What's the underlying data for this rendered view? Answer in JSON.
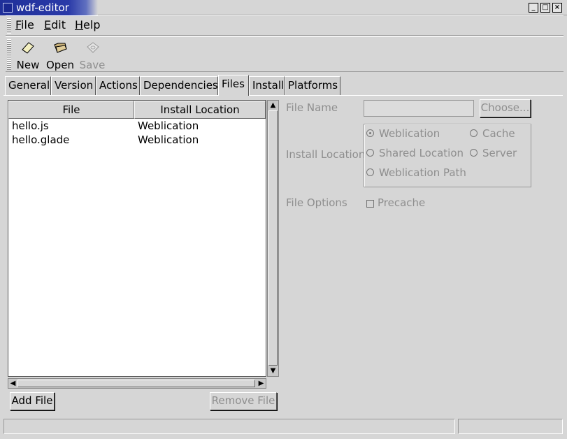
{
  "window": {
    "title": "wdf-editor",
    "wm_buttons": [
      "minimize-icon",
      "maximize-icon",
      "close-icon"
    ]
  },
  "menubar": {
    "items": [
      {
        "label": "File",
        "mnemonic": "F",
        "rest": "ile"
      },
      {
        "label": "Edit",
        "mnemonic": "E",
        "rest": "dit"
      },
      {
        "label": "Help",
        "mnemonic": "H",
        "rest": "elp"
      }
    ]
  },
  "toolbar": {
    "new_label": "New",
    "open_label": "Open",
    "save_label": "Save",
    "icons": {
      "new": "new-document-icon",
      "open": "open-folder-icon",
      "save": "save-disk-icon"
    }
  },
  "tabs": [
    "General",
    "Version",
    "Actions",
    "Dependencies",
    "Files",
    "Install",
    "Platforms"
  ],
  "active_tab": "Files",
  "files_table": {
    "columns": [
      "File",
      "Install Location"
    ],
    "rows": [
      {
        "file": "hello.js",
        "location": "Weblication"
      },
      {
        "file": "hello.glade",
        "location": "Weblication"
      }
    ]
  },
  "buttons": {
    "add_file": "Add File",
    "remove_file": "Remove File",
    "choose": "Choose..."
  },
  "form": {
    "file_name_label": "File Name",
    "file_name_value": "",
    "install_location_label": "Install Location",
    "location_options": [
      "Weblication",
      "Cache",
      "Shared Location",
      "Server",
      "Weblication Path"
    ],
    "selected_location": "Weblication",
    "file_options_label": "File Options",
    "precache_label": "Precache",
    "precache_checked": false
  },
  "colors": {
    "title_bar": "#20309a",
    "window_bg": "#d6d6d6",
    "disabled_text": "#8e8e8e"
  }
}
